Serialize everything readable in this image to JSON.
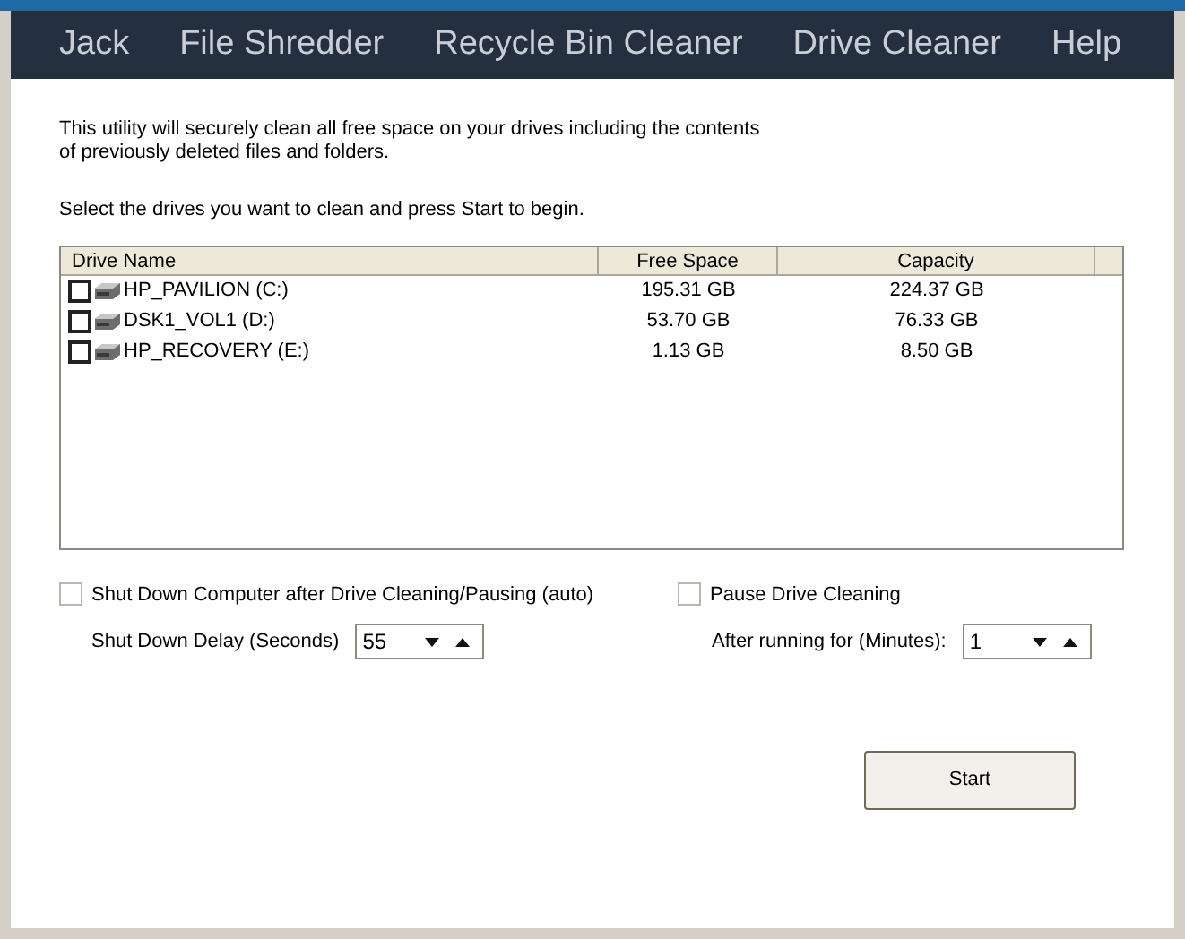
{
  "nav": {
    "items": [
      "Jack",
      "File Shredder",
      "Recycle Bin Cleaner",
      "Drive Cleaner",
      "Help"
    ]
  },
  "intro": "This utility will securely clean all free space on your drives including the contents of previously deleted files and folders.",
  "instruction": "Select the drives you want to clean and press Start to begin.",
  "table": {
    "columns": [
      "Drive Name",
      "Free Space",
      "Capacity"
    ],
    "rows": [
      {
        "name": "HP_PAVILION (C:)",
        "free": "195.31 GB",
        "capacity": "224.37 GB",
        "checked": false
      },
      {
        "name": "DSK1_VOL1 (D:)",
        "free": "53.70 GB",
        "capacity": "76.33 GB",
        "checked": false
      },
      {
        "name": "HP_RECOVERY (E:)",
        "free": "1.13 GB",
        "capacity": "8.50 GB",
        "checked": false
      }
    ]
  },
  "shutdown": {
    "label": "Shut Down Computer after Drive Cleaning/Pausing (auto)",
    "checked": false,
    "delay_label": "Shut Down Delay (Seconds)",
    "delay_value": "55"
  },
  "pause": {
    "label": "Pause Drive Cleaning",
    "checked": false,
    "after_label": "After running for (Minutes):",
    "after_value": "1"
  },
  "start_button": "Start"
}
